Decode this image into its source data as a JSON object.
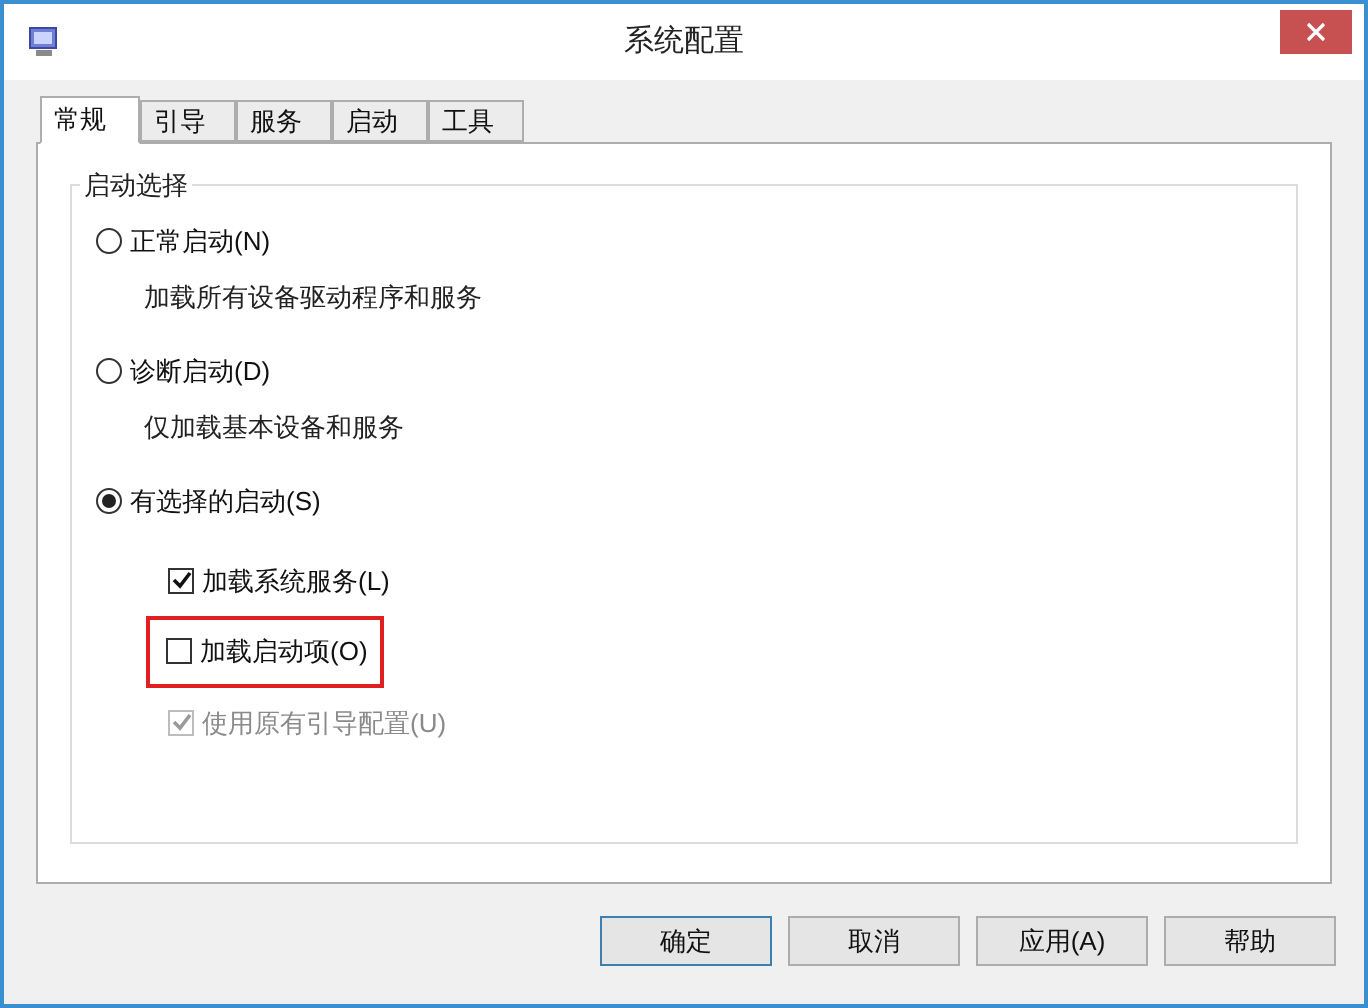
{
  "window": {
    "title": "系统配置"
  },
  "tabs": [
    {
      "label": "常规",
      "selected": true
    },
    {
      "label": "引导",
      "selected": false
    },
    {
      "label": "服务",
      "selected": false
    },
    {
      "label": "启动",
      "selected": false
    },
    {
      "label": "工具",
      "selected": false
    }
  ],
  "startup_selection": {
    "title": "启动选择",
    "options": [
      {
        "label": "正常启动(N)",
        "description": "加载所有设备驱动程序和服务",
        "selected": false
      },
      {
        "label": "诊断启动(D)",
        "description": "仅加载基本设备和服务",
        "selected": false
      },
      {
        "label": "有选择的启动(S)",
        "selected": true
      }
    ],
    "sub_options": [
      {
        "label": "加载系统服务(L)",
        "checked": true,
        "disabled": false,
        "highlighted": false
      },
      {
        "label": "加载启动项(O)",
        "checked": false,
        "disabled": false,
        "highlighted": true
      },
      {
        "label": "使用原有引导配置(U)",
        "checked": true,
        "disabled": true,
        "highlighted": false
      }
    ]
  },
  "buttons": [
    {
      "label": "确定",
      "default": true
    },
    {
      "label": "取消",
      "default": false
    },
    {
      "label": "应用(A)",
      "default": false
    },
    {
      "label": "帮助",
      "default": false
    }
  ]
}
